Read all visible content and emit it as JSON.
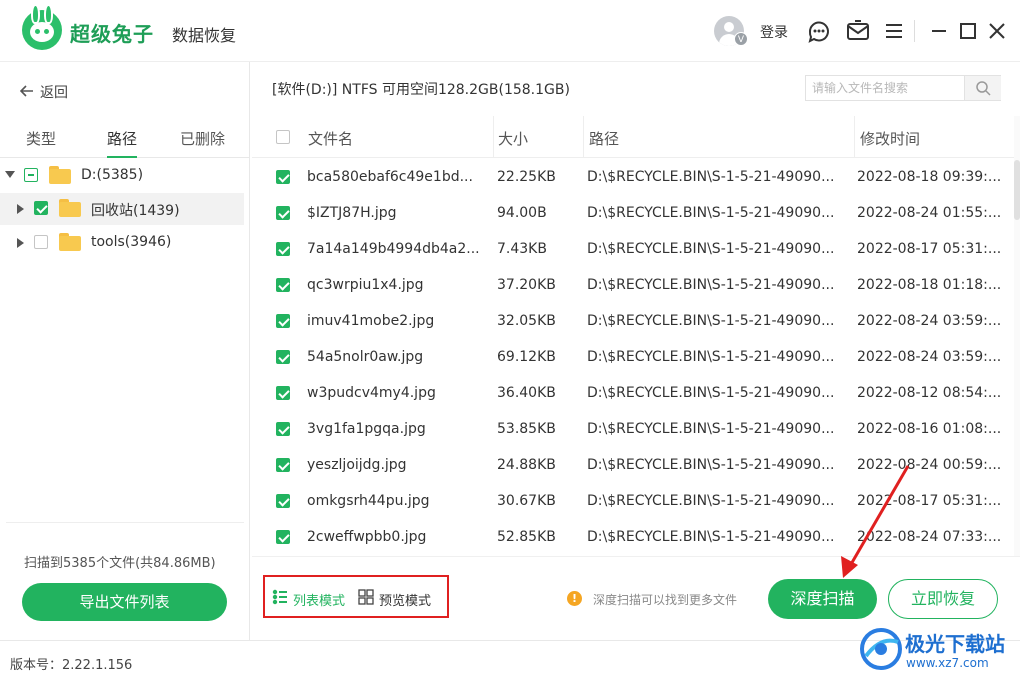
{
  "app": {
    "brand": "超级兔子",
    "product": "数据恢复",
    "login_label": "登录",
    "avatar_badge": "V",
    "icons": [
      "user-avatar-icon",
      "support-chat-icon",
      "feedback-mail-icon",
      "menu-icon",
      "minimize-icon",
      "maximize-icon",
      "close-icon"
    ]
  },
  "sidebar": {
    "back_label": "返回",
    "tabs": [
      {
        "label": "类型"
      },
      {
        "label": "路径"
      },
      {
        "label": "已删除"
      }
    ],
    "active_tab": "路径",
    "tree": [
      {
        "label": "D:(5385)",
        "state": "partial",
        "expanded": true
      },
      {
        "label": "回收站(1439)",
        "state": "checked",
        "expanded": false
      },
      {
        "label": "tools(3946)",
        "state": "unchecked",
        "expanded": false
      }
    ],
    "scan_summary": "扫描到5385个文件(共84.86MB)",
    "export_button": "导出文件列表"
  },
  "main": {
    "path_info": "[软件(D:)] NTFS 可用空间128.2GB(158.1GB)",
    "search_placeholder": "请输入文件名搜索",
    "columns": {
      "name": "文件名",
      "size": "大小",
      "path": "路径",
      "modified": "修改时间"
    },
    "rows": [
      {
        "name": "bca580ebaf6c49e1bd...",
        "size": "22.25KB",
        "path": "D:\\$RECYCLE.BIN\\S-1-5-21-49090...",
        "modified": "2022-08-18 09:39:..."
      },
      {
        "name": "$IZTJ87H.jpg",
        "size": "94.00B",
        "path": "D:\\$RECYCLE.BIN\\S-1-5-21-49090...",
        "modified": "2022-08-24 01:55:..."
      },
      {
        "name": "7a14a149b4994db4a2...",
        "size": "7.43KB",
        "path": "D:\\$RECYCLE.BIN\\S-1-5-21-49090...",
        "modified": "2022-08-17 05:31:..."
      },
      {
        "name": "qc3wrpiu1x4.jpg",
        "size": "37.20KB",
        "path": "D:\\$RECYCLE.BIN\\S-1-5-21-49090...",
        "modified": "2022-08-18 01:18:..."
      },
      {
        "name": "imuv41mobe2.jpg",
        "size": "32.05KB",
        "path": "D:\\$RECYCLE.BIN\\S-1-5-21-49090...",
        "modified": "2022-08-24 03:59:..."
      },
      {
        "name": "54a5nolr0aw.jpg",
        "size": "69.12KB",
        "path": "D:\\$RECYCLE.BIN\\S-1-5-21-49090...",
        "modified": "2022-08-24 03:59:..."
      },
      {
        "name": "w3pudcv4my4.jpg",
        "size": "36.40KB",
        "path": "D:\\$RECYCLE.BIN\\S-1-5-21-49090...",
        "modified": "2022-08-12 08:54:..."
      },
      {
        "name": "3vg1fa1pgqa.jpg",
        "size": "53.85KB",
        "path": "D:\\$RECYCLE.BIN\\S-1-5-21-49090...",
        "modified": "2022-08-16 01:08:..."
      },
      {
        "name": "yeszljoijdg.jpg",
        "size": "24.88KB",
        "path": "D:\\$RECYCLE.BIN\\S-1-5-21-49090...",
        "modified": "2022-08-24 00:59:..."
      },
      {
        "name": "omkgsrh44pu.jpg",
        "size": "30.67KB",
        "path": "D:\\$RECYCLE.BIN\\S-1-5-21-49090...",
        "modified": "2022-08-17 05:31:..."
      },
      {
        "name": "2cweffwpbb0.jpg",
        "size": "52.85KB",
        "path": "D:\\$RECYCLE.BIN\\S-1-5-21-49090...",
        "modified": "2022-08-24 07:33:..."
      }
    ]
  },
  "footer": {
    "list_mode": "列表模式",
    "preview_mode": "预览模式",
    "hint_icon": "!",
    "hint": "深度扫描可以找到更多文件",
    "deep_scan": "深度扫描",
    "recover_now": "立即恢复",
    "version": "版本号：2.22.1.156"
  },
  "watermark": {
    "name": "极光下载站",
    "url": "www.xz7.com"
  },
  "colors": {
    "accent": "#22b35f",
    "annotation": "#e02020",
    "warning": "#f5a623"
  }
}
